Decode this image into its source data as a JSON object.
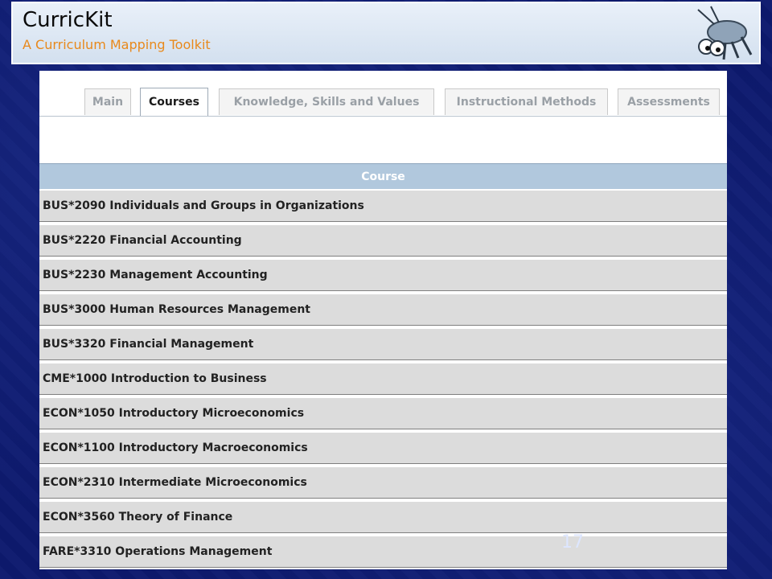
{
  "banner": {
    "title": "CurricKit",
    "subtitle": "A Curriculum Mapping Toolkit",
    "logo_icon": "cricket-mascot-icon"
  },
  "tabs": [
    {
      "label": "Main",
      "active": false
    },
    {
      "label": "Courses",
      "active": true
    },
    {
      "label": "Knowledge, Skills and Values",
      "active": false
    },
    {
      "label": "Instructional Methods",
      "active": false
    },
    {
      "label": "Assessments",
      "active": false
    }
  ],
  "table": {
    "header": "Course",
    "rows": [
      "BUS*2090 Individuals and Groups in Organizations",
      "BUS*2220 Financial Accounting",
      "BUS*2230 Management Accounting",
      "BUS*3000 Human Resources Management",
      "BUS*3320 Financial Management",
      "CME*1000 Introduction to Business",
      "ECON*1050 Introductory Microeconomics",
      "ECON*1100 Introductory Macroeconomics",
      "ECON*2310 Intermediate Microeconomics",
      "ECON*3560 Theory of Finance",
      "FARE*3310 Operations Management"
    ]
  },
  "slide": {
    "page_number": "17"
  },
  "colors": {
    "background": "#0d1a6e",
    "subtitle": "#e8891b",
    "table_header": "#b1c8dd",
    "row": "#dcdcdc"
  }
}
